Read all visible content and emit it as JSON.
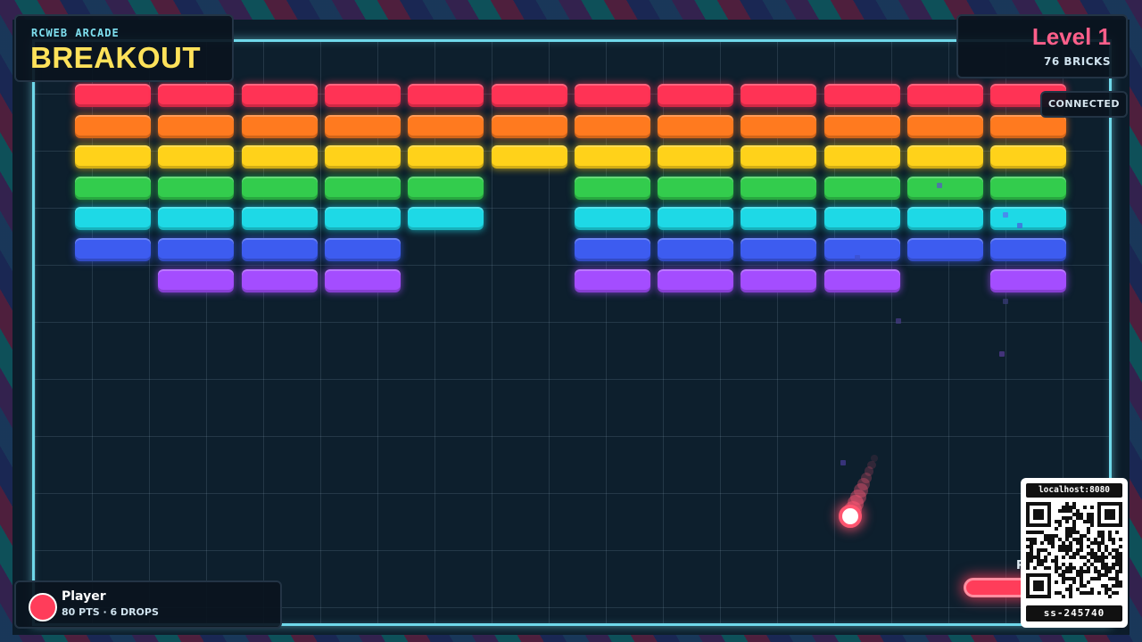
{
  "header": {
    "subtitle": "RCWEB ARCADE",
    "title": "BREAKOUT"
  },
  "level": {
    "label": "Level 1",
    "bricks": "76 BRICKS"
  },
  "status": "CONNECTED",
  "player": {
    "name": "Player",
    "stats": "80 PTS · 6 DROPS",
    "color": "#ff3d5a"
  },
  "paddle_tag": "P",
  "qr": {
    "url": "localhost:8080",
    "session_id": "ss-245740"
  },
  "colors": {
    "rows": [
      "#ff3355",
      "#ff7a1f",
      "#ffd21a",
      "#33cc4d",
      "#1ed9e6",
      "#3d5cf0",
      "#a44dff"
    ],
    "accent_title": "#ffe25a",
    "accent_level": "#ff5f8a",
    "arena_border": "#6fd8ea"
  },
  "brick_rows": [
    [
      1,
      1,
      1,
      1,
      1,
      1,
      1,
      1,
      1,
      1,
      1,
      1
    ],
    [
      1,
      1,
      1,
      1,
      1,
      1,
      1,
      1,
      1,
      1,
      1,
      1
    ],
    [
      1,
      1,
      1,
      1,
      1,
      1,
      1,
      1,
      1,
      1,
      1,
      1
    ],
    [
      1,
      1,
      1,
      1,
      1,
      0,
      1,
      1,
      1,
      1,
      1,
      1
    ],
    [
      1,
      1,
      1,
      1,
      1,
      0,
      1,
      1,
      1,
      1,
      1,
      1
    ],
    [
      1,
      1,
      1,
      1,
      0,
      0,
      1,
      1,
      1,
      1,
      1,
      1
    ],
    [
      0,
      1,
      1,
      1,
      0,
      0,
      1,
      1,
      1,
      1,
      0,
      1
    ]
  ]
}
